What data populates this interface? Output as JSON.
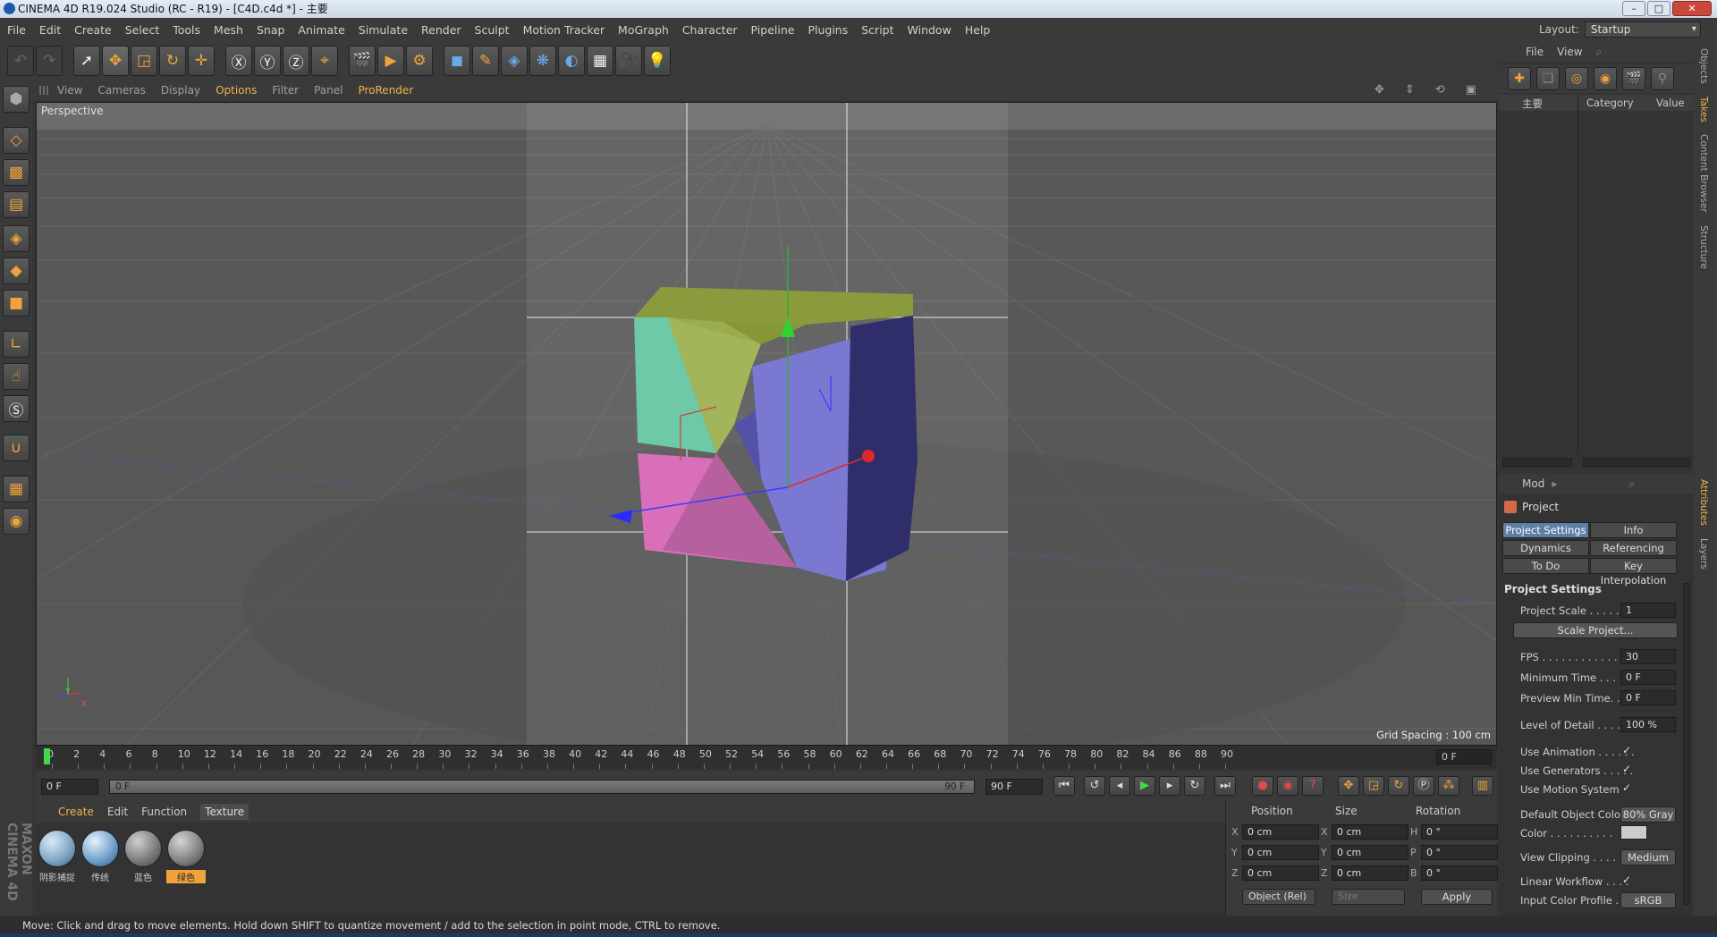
{
  "window": {
    "title": "CINEMA 4D R19.024 Studio (RC - R19) - [C4D.c4d *] - 主要",
    "min": "–",
    "max": "□",
    "close": "✕"
  },
  "menu": [
    "File",
    "Edit",
    "Create",
    "Select",
    "Tools",
    "Mesh",
    "Snap",
    "Animate",
    "Simulate",
    "Render",
    "Sculpt",
    "Motion Tracker",
    "MoGraph",
    "Character",
    "Pipeline",
    "Plugins",
    "Script",
    "Window",
    "Help"
  ],
  "layout": {
    "label": "Layout:",
    "value": "Startup"
  },
  "viewport_menu": [
    "View",
    "Cameras",
    "Display",
    "Options",
    "Filter",
    "Panel",
    "ProRender"
  ],
  "viewport": {
    "name": "Perspective",
    "grid_spacing": "Grid Spacing : 100 cm",
    "axis_y": "Y",
    "axis_x": "X"
  },
  "timeline": {
    "ticks": [
      "0",
      "2",
      "4",
      "6",
      "8",
      "10",
      "12",
      "14",
      "16",
      "18",
      "20",
      "22",
      "24",
      "26",
      "28",
      "30",
      "32",
      "34",
      "36",
      "38",
      "40",
      "42",
      "44",
      "46",
      "48",
      "50",
      "52",
      "54",
      "56",
      "58",
      "60",
      "62",
      "64",
      "66",
      "68",
      "70",
      "72",
      "74",
      "76",
      "78",
      "80",
      "82",
      "84",
      "86",
      "88",
      "90"
    ],
    "current": "0 F"
  },
  "transport": {
    "start": "0 F",
    "range_start": "0 F",
    "range_end": "90 F",
    "end": "90 F"
  },
  "material_menu": [
    "Create",
    "Edit",
    "Function",
    "Texture"
  ],
  "materials": [
    {
      "name": "阴影捕捉",
      "color": "#8fb4d4"
    },
    {
      "name": "传统",
      "color": "#7aa6d0"
    },
    {
      "name": "蓝色",
      "color": "#7d7d7d"
    },
    {
      "name": "绿色",
      "color": "#808080"
    }
  ],
  "coords": {
    "headers": [
      "Position",
      "Size",
      "Rotation"
    ],
    "rows": [
      {
        "a1": "X",
        "v1": "0 cm",
        "a2": "X",
        "v2": "0 cm",
        "a3": "H",
        "v3": "0 °"
      },
      {
        "a1": "Y",
        "v1": "0 cm",
        "a2": "Y",
        "v2": "0 cm",
        "a3": "P",
        "v3": "0 °"
      },
      {
        "a1": "Z",
        "v1": "0 cm",
        "a2": "Z",
        "v2": "0 cm",
        "a3": "B",
        "v3": "0 °"
      }
    ],
    "mode": "Object (Rel)",
    "size_mode": "Size",
    "apply": "Apply"
  },
  "status": "Move: Click and drag to move elements. Hold down SHIFT to quantize movement / add to the selection in point mode, CTRL to remove.",
  "objects": {
    "menu": [
      "File",
      "View"
    ],
    "col_name": "主要",
    "col_category": "Category",
    "col_value": "Value"
  },
  "attributes": {
    "menu": "Mod",
    "object": "Project",
    "tabs": [
      "Project Settings",
      "Info",
      "Dynamics",
      "Referencing",
      "To Do",
      "Key Interpolation"
    ],
    "section": "Project Settings",
    "rows": [
      {
        "label": "Project Scale . . . . . . .",
        "value": "1"
      },
      {
        "label": "FPS . . . . . . . . . . . . . . .",
        "value": "30"
      },
      {
        "label": "Minimum Time . . . . . .",
        "value": "0 F"
      },
      {
        "label": "Preview Min Time. . . .",
        "value": "0 F"
      },
      {
        "label": "Level of Detail . . . . . .",
        "value": "100 %"
      }
    ],
    "scale_button": "Scale Project...",
    "checks": [
      "Use Animation . . . . . .",
      "Use Generators . . . . .",
      "Use Motion System"
    ],
    "check_mark": "✓",
    "default_color_label": "Default Object Color",
    "default_color_value": "80% Gray",
    "color_label": "Color . . . . . . . . . .",
    "view_clipping_label": "View Clipping . . . . . .",
    "view_clipping_value": "Medium",
    "linear_label": "Linear Workflow . . . .",
    "profile_label": "Input Color Profile . . .",
    "profile_value": "sRGB"
  },
  "side_tabs": [
    "Objects",
    "Takes",
    "Content Browser",
    "Structure",
    "Attributes",
    "Layers"
  ],
  "brand": "MAXON CINEMA 4D"
}
